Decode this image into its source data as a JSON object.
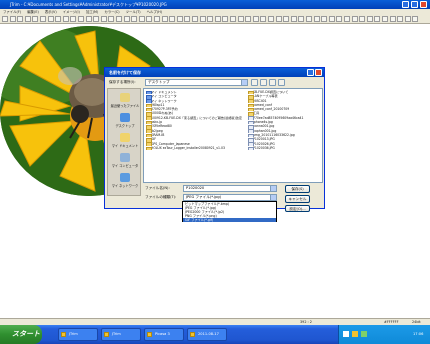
{
  "app": {
    "title": "JTrim - C:¥Documents and Settings¥Administrator¥デスクトップ¥P1020020.JPG",
    "menu": [
      "ファイル(F)",
      "編集(E)",
      "表示(V)",
      "イメージ(I)",
      "加工(M)",
      "カラー(C)",
      "ツール(T)",
      "ヘルプ(H)"
    ]
  },
  "status": {
    "coords": "392 : 2",
    "color": "#FFFFFF",
    "depth": "24bit"
  },
  "dialog": {
    "title": "名前を付けて保存",
    "save_in_label": "保存する場所(I):",
    "save_in_value": "デスクトップ",
    "places": [
      {
        "label": "最近使ったファイル",
        "icon": "recent-icon"
      },
      {
        "label": "デスクトップ",
        "icon": "desktop-icon"
      },
      {
        "label": "マイ ドキュメント",
        "icon": "my-documents-icon"
      },
      {
        "label": "マイ コンピュータ",
        "icon": "my-computer-icon"
      },
      {
        "label": "マイ ネットワーク",
        "icon": "my-network-icon"
      }
    ],
    "files_col1": [
      {
        "name": "マイ ドキュメント",
        "kind": "special"
      },
      {
        "name": "マイ コンピュータ",
        "kind": "special"
      },
      {
        "name": "マイ ネットワーク",
        "kind": "special"
      },
      {
        "name": "260sp11",
        "kind": "folder"
      },
      {
        "name": "070927P-3FE予約",
        "kind": "folder"
      },
      {
        "name": "1000Dれぬ(あ)",
        "kind": "folder"
      },
      {
        "name": "100912-KB-FUE-DX「東る調査」についてのご報告(最終版)改定",
        "kind": "folder"
      },
      {
        "name": "askx-jp",
        "kind": "folder"
      },
      {
        "name": "ESFileRead80",
        "kind": "folder"
      },
      {
        "name": "fb2jpeg",
        "kind": "folder"
      },
      {
        "name": "GRAM-IB",
        "kind": "folder"
      },
      {
        "name": "GIF",
        "kind": "folder"
      },
      {
        "name": "GPS_Computer_Japanese",
        "kind": "folder"
      },
      {
        "name": "HOLUX ezTour_Logger_installer20080921_v1.03",
        "kind": "folder"
      }
    ],
    "files_col2": [
      {
        "name": "KB-FUE-DX調査について",
        "kind": "folder"
      },
      {
        "name": "LANケーブル等表",
        "kind": "folder"
      },
      {
        "name": "MISC401",
        "kind": "folder"
      },
      {
        "name": "named_conf",
        "kind": "folder"
      },
      {
        "name": "named_conf_20100709",
        "kind": "folder"
      },
      {
        "name": "工具",
        "kind": "folder"
      },
      {
        "name": "770ee7ad8574095609aa46ca41",
        "kind": "file"
      },
      {
        "name": "iphone4s.jpg",
        "kind": "file"
      },
      {
        "name": "nanna001.jpg",
        "kind": "file"
      },
      {
        "name": "naphan001.jpg",
        "kind": "file"
      },
      {
        "name": "omg_20101116033622.jpg",
        "kind": "file"
      },
      {
        "name": "P1020013.JPG",
        "kind": "file"
      },
      {
        "name": "P1020026.JPG",
        "kind": "file"
      },
      {
        "name": "P1020036.JPG",
        "kind": "file"
      }
    ],
    "filename_label": "ファイル名(N):",
    "filename_value": "P1020020",
    "filetype_label": "ファイルの種類(T):",
    "filetype_value": "JPEG ファイル(*.jpg)",
    "save_button": "保存(S)",
    "cancel_button": "キャンセル",
    "settings_button": "設定(O)...",
    "type_options": [
      "ビットマップファイル(*.bmp)",
      "JPEG ファイル(*.jpg)",
      "JPEG2000 ファイル(*.jp2)",
      "PNG ファイル(*.png)",
      "GIF ファイル(*.gif)"
    ],
    "type_selected_index": 4
  },
  "taskbar": {
    "start_label": "スタート",
    "tasks": [
      "JTrim",
      "JTrim",
      "Picasa 3",
      "2011-08-17"
    ],
    "time": "17:06"
  }
}
